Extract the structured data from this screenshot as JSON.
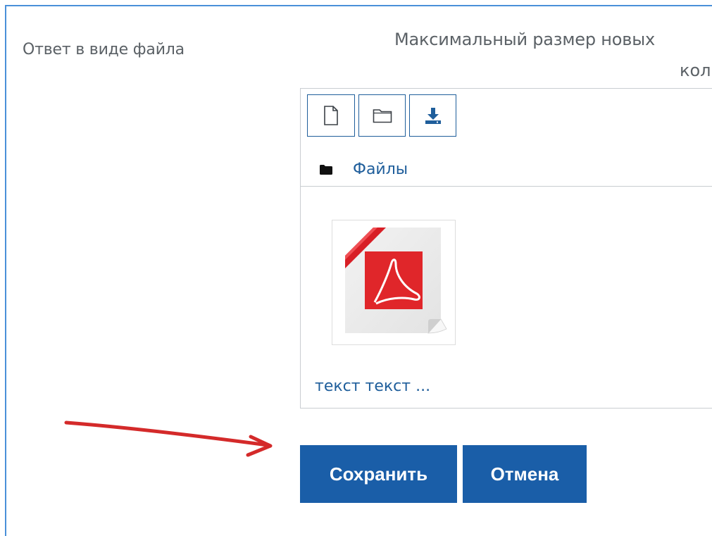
{
  "form": {
    "field_label": "Ответ в виде файла",
    "maxsize_text_line1": "Максимальный размер новых",
    "maxsize_text_line2": "кол"
  },
  "filemanager": {
    "toolbar": {
      "add_file_icon": "file-icon",
      "create_folder_icon": "folder-icon",
      "download_icon": "download-icon"
    },
    "path": {
      "folder_icon": "folder-filled-icon",
      "label": "Файлы"
    },
    "files": [
      {
        "icon": "pdf-file-icon",
        "name": "текст текст ..."
      }
    ]
  },
  "actions": {
    "save_label": "Сохранить",
    "cancel_label": "Отмена"
  },
  "colors": {
    "accent": "#1a5ea8",
    "link": "#1f5e9b",
    "frame_border": "#4a90d9",
    "annotation_arrow": "#d42a2a",
    "pdf_red": "#e0262a"
  }
}
